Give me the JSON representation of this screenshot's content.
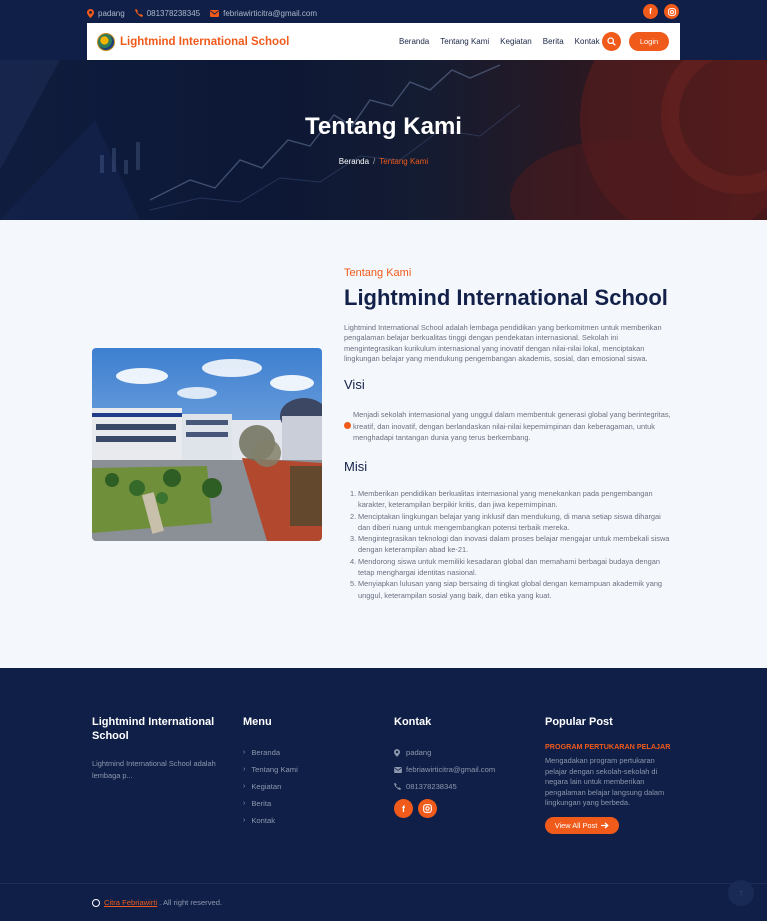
{
  "topbar": {
    "location": "padang",
    "phone": "081378238345",
    "email": "febriawirticitra@gmail.com"
  },
  "nav": {
    "brand": "Lightmind International School",
    "links": [
      "Beranda",
      "Tentang Kami",
      "Kegiatan",
      "Berita",
      "Kontak"
    ],
    "login": "Login"
  },
  "hero": {
    "title": "Tentang Kami",
    "breadcrumb": {
      "home": "Beranda",
      "separator": "/",
      "current": "Tentang Kami"
    }
  },
  "about": {
    "eyebrow": "Tentang Kami",
    "title": "Lightmind International School",
    "description": "Lightmind International School adalah lembaga pendidikan yang berkomitmen untuk memberikan pengalaman belajar berkualitas tinggi dengan pendekatan internasional. Sekolah ini mengintegrasikan kurikulum internasional yang inovatif dengan nilai-nilai lokal, menciptakan lingkungan belajar yang mendukung pengembangan akademis, sosial, dan emosional siswa.",
    "visi_heading": "Visi",
    "visi_text": "Menjadi sekolah internasional yang unggul dalam membentuk generasi global yang berintegritas, kreatif, dan inovatif, dengan berlandaskan nilai-nilai kepemimpinan dan keberagaman, untuk menghadapi tantangan dunia yang terus berkembang.",
    "misi_heading": "Misi",
    "misi": [
      "Memberikan pendidikan berkualitas internasional yang menekankan pada pengembangan karakter, keterampilan berpikir kritis, dan jiwa kepemimpinan.",
      "Menciptakan lingkungan belajar yang inklusif dan mendukung, di mana setiap siswa dihargai dan diberi ruang untuk mengembangkan potensi terbaik mereka.",
      "Mengintegrasikan teknologi dan inovasi dalam proses belajar mengajar untuk membekali siswa dengan keterampilan abad ke-21.",
      "Mendorong siswa untuk memiliki kesadaran global dan memahami berbagai budaya dengan tetap menghargai identitas nasional.",
      "Menyiapkan lulusan yang siap bersaing di tingkat global dengan kemampuan akademik yang unggul, keterampilan sosial yang baik, dan etika yang kuat."
    ]
  },
  "footer": {
    "about_title": "Lightmind International School",
    "about_text": "Lightmind International School adalah lembaga p...",
    "menu_title": "Menu",
    "menu": [
      "Beranda",
      "Tentang Kami",
      "Kegiatan",
      "Berita",
      "Kontak"
    ],
    "contact_title": "Kontak",
    "contact_location": "padang",
    "contact_email": "febriawirticitra@gmail.com",
    "contact_phone": "081378238345",
    "popular_title": "Popular Post",
    "popular_post_title": "PROGRAM PERTUKARAN PELAJAR",
    "popular_post_text": "Mengadakan program pertukaran pelajar dengan sekolah-sekolah di negara lain untuk memberikan pengalaman belajar langsung dalam lingkungan yang berbeda.",
    "view_all": "View All Post",
    "copyright_name": "Citra Febriawirti",
    "copyright_suffix": ". All right reserved."
  },
  "colors": {
    "accent": "#f05a1a",
    "navy": "#0f1f47",
    "heading": "#13214a"
  },
  "icons": [
    "location-icon",
    "phone-icon",
    "email-icon",
    "facebook-icon",
    "instagram-icon",
    "search-icon",
    "check-circle-icon",
    "chevron-right-icon",
    "arrow-right-icon",
    "arrow-up-icon"
  ]
}
